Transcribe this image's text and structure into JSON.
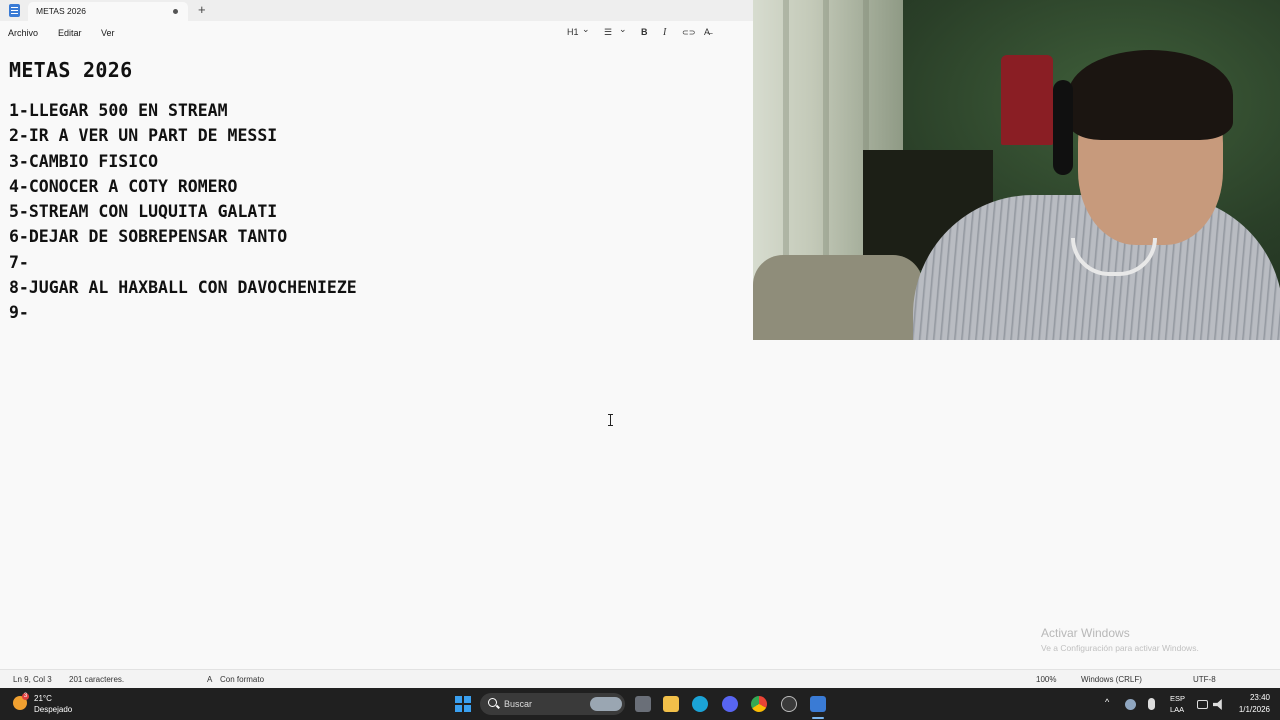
{
  "window": {
    "tab_title": "METAS 2026",
    "new_tab_symbol": "+"
  },
  "menu": {
    "items": [
      "Archivo",
      "Editar",
      "Ver"
    ]
  },
  "toolbar": {
    "heading": "H1",
    "heading_chevron": "⌄",
    "list_symbol": "☰",
    "list_chevron": "⌄",
    "bold": "B",
    "italic": "I",
    "link_symbol": "⊂⊃",
    "clear_format_symbol": "A̶"
  },
  "document": {
    "title": "METAS 2026",
    "lines": [
      "1-LLEGAR 500 EN STREAM",
      "2-IR A VER UN PART DE MESSI",
      "3-CAMBIO FISICO",
      "4-CONOCER A COTY ROMERO",
      "5-STREAM CON LUQUITA GALATI",
      "6-DEJAR DE SOBREPENSAR TANTO",
      "7-",
      "8-JUGAR AL HAXBALL CON DAVOCHENIEZE",
      "9-"
    ]
  },
  "watermark": {
    "title": "Activar Windows",
    "subtitle": "Ve a Configuración para activar Windows."
  },
  "status": {
    "position": "Ln 9, Col 3",
    "chars": "201 caracteres.",
    "format": "Con formato",
    "zoom": "100%",
    "line_ending": "Windows (CRLF)",
    "encoding": "UTF-8"
  },
  "taskbar": {
    "weather_badge": "3",
    "weather_temp": "21°C",
    "weather_desc": "Despejado",
    "search_placeholder": "Buscar",
    "tray_chevron": "^",
    "lang_1": "ESP",
    "lang_2": "LAA",
    "time": "23:40",
    "date": "1/1/2026"
  },
  "colors": {
    "accent": "#3aa0f0",
    "taskbar_bg": "#202020",
    "editor_bg": "#f9f9f9"
  }
}
